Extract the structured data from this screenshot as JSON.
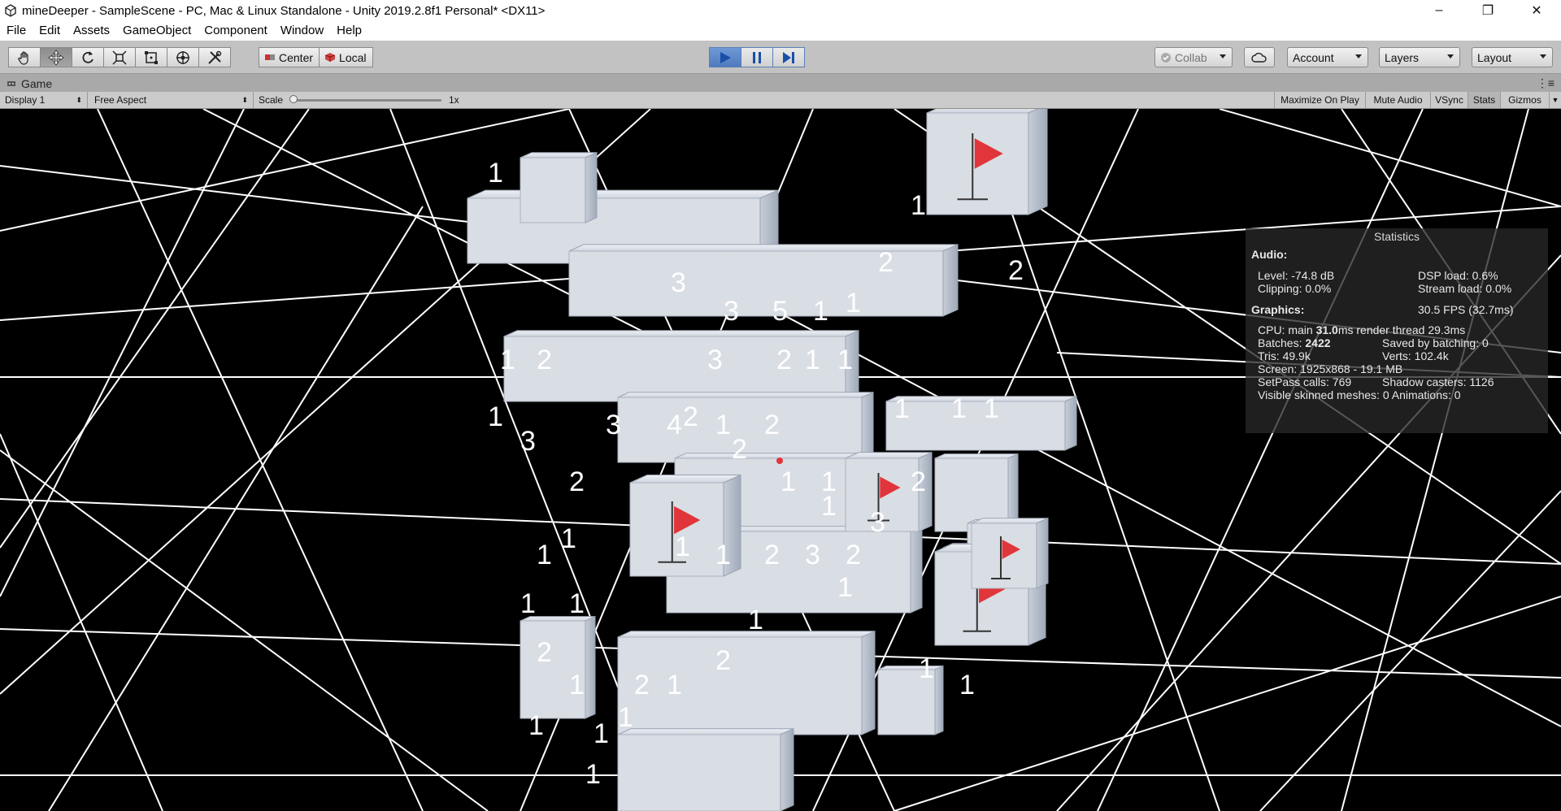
{
  "window": {
    "title": "mineDeeper - SampleScene - PC, Mac & Linux Standalone - Unity 2019.2.8f1 Personal* <DX11>",
    "controls": [
      "–",
      "❐",
      "✕"
    ]
  },
  "menu": [
    "File",
    "Edit",
    "Assets",
    "GameObject",
    "Component",
    "Window",
    "Help"
  ],
  "toolbar": {
    "tools": [
      "hand-tool",
      "move-tool",
      "rotate-tool",
      "scale-tool",
      "rect-tool",
      "transform-tool",
      "custom-tool"
    ],
    "active_tool": "move-tool",
    "pivot_center": "Center",
    "pivot_local": "Local",
    "play_state": "playing",
    "collab": "Collab",
    "account": "Account",
    "layers": "Layers",
    "layout": "Layout"
  },
  "tab": {
    "label": "Game",
    "menu": "⋮≡"
  },
  "game_bar": {
    "display": "Display 1",
    "aspect": "Free Aspect",
    "scale_label": "Scale",
    "scale_value": "1x",
    "toggles": [
      "Maximize On Play",
      "Mute Audio",
      "VSync",
      "Stats",
      "Gizmos"
    ]
  },
  "stats": {
    "title": "Statistics",
    "audio_head": "Audio:",
    "level": "Level: -74.8 dB",
    "clipping": "Clipping: 0.0%",
    "dsp": "DSP load: 0.6%",
    "stream": "Stream load: 0.0%",
    "graphics_head": "Graphics:",
    "fps": "30.5 FPS (32.7ms)",
    "cpu_prefix": "CPU: main ",
    "cpu_main": "31.0",
    "cpu_suffix": "ms  render thread 29.3ms",
    "batches_prefix": "Batches: ",
    "batches": "2422",
    "saved": "Saved by batching: 0",
    "tris": "Tris: 49.9k",
    "verts": "Verts: 102.4k",
    "screen": "Screen: 1925x868 - 19.1 MB",
    "setpass": "SetPass calls: 769",
    "shadow": "Shadow casters: 1126",
    "skinned": "Visible skinned meshes: 0  Animations: 0"
  },
  "scene": {
    "numbers": [
      "3",
      "2",
      "1",
      "3",
      "2",
      "1",
      "1",
      "2",
      "1",
      "3",
      "4",
      "1",
      "2",
      "1",
      "3",
      "5",
      "1",
      "2",
      "1",
      "2",
      "1",
      "1",
      "2",
      "3",
      "1",
      "1",
      "2",
      "3",
      "2",
      "1",
      "2",
      "1",
      "1",
      "1",
      "1",
      "1",
      "2",
      "1",
      "1",
      "1",
      "1",
      "1",
      "2",
      "1",
      "2",
      "1",
      "3",
      "2",
      "1",
      "1",
      "1",
      "1",
      "1",
      "1"
    ],
    "colors": {
      "cube": "#d9dde4",
      "cube_shade": "#b8bfca",
      "wire": "#ffffff",
      "flag": "#e0353a"
    }
  }
}
